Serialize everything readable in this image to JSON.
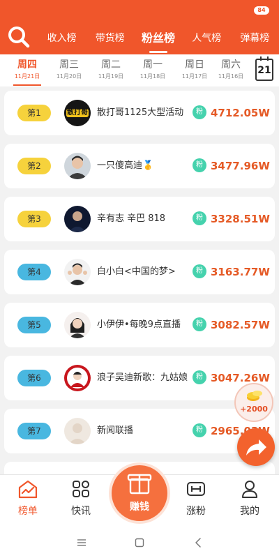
{
  "status_bar": {
    "battery": "84"
  },
  "header": {
    "tabs": [
      {
        "label": "收入榜",
        "active": false
      },
      {
        "label": "带货榜",
        "active": false
      },
      {
        "label": "粉丝榜",
        "active": true
      },
      {
        "label": "人气榜",
        "active": false
      },
      {
        "label": "弹幕榜",
        "active": false
      }
    ]
  },
  "days": [
    {
      "weekday": "周四",
      "date": "11月21日",
      "active": true
    },
    {
      "weekday": "周三",
      "date": "11月20日",
      "active": false
    },
    {
      "weekday": "周二",
      "date": "11月19日",
      "active": false
    },
    {
      "weekday": "周一",
      "date": "11月18日",
      "active": false
    },
    {
      "weekday": "周日",
      "date": "11月17日",
      "active": false
    },
    {
      "weekday": "周六",
      "date": "11月16日",
      "active": false
    }
  ],
  "calendar": {
    "day": "21"
  },
  "ranking": [
    {
      "rank": "第1",
      "name": "散打哥1125大型活动",
      "badge": "粉",
      "value": "4712.05W"
    },
    {
      "rank": "第2",
      "name": "一只傻高迪🥇",
      "badge": "粉",
      "value": "3477.96W"
    },
    {
      "rank": "第3",
      "name": "辛有志 辛巴 818",
      "badge": "粉",
      "value": "3328.51W"
    },
    {
      "rank": "第4",
      "name": "白小白<中国的梦>",
      "badge": "粉",
      "value": "3163.77W"
    },
    {
      "rank": "第5",
      "name": "小伊伊•每晚9点直播",
      "badge": "粉",
      "value": "3082.57W"
    },
    {
      "rank": "第6",
      "name": "浪子吴迪新歌：九姑娘",
      "badge": "粉",
      "value": "3047.26W"
    },
    {
      "rank": "第7",
      "name": "新闻联播",
      "badge": "粉",
      "value": "2965.03W"
    }
  ],
  "avatar_1_text": "散打哥",
  "floating": {
    "coin_reward": "+2000"
  },
  "bottom_nav": {
    "items": [
      {
        "label": "榜单",
        "active": true
      },
      {
        "label": "快讯",
        "active": false
      },
      {
        "label": "赚钱",
        "active": false
      },
      {
        "label": "涨粉",
        "active": false
      },
      {
        "label": "我的",
        "active": false
      }
    ]
  },
  "colors": {
    "brand": "#f0562b",
    "value_text": "#e55a26",
    "rank_top3": "#f6d23c",
    "rank_other": "#49b7e0",
    "fan_badge": "#45d2ad"
  }
}
